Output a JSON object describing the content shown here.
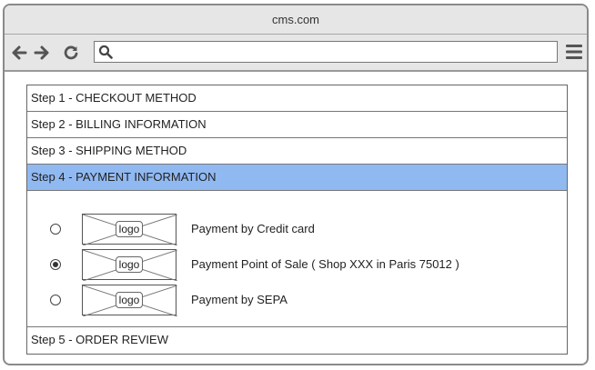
{
  "browser": {
    "title": "cms.com",
    "url": ""
  },
  "steps": {
    "s1": "Step 1 - CHECKOUT METHOD",
    "s2": "Step 2 - BILLING INFORMATION",
    "s3": "Step 3 - SHIPPING METHOD",
    "s4": "Step 4 - PAYMENT INFORMATION",
    "s5": "Step 5 - ORDER REVIEW"
  },
  "payment": {
    "options": [
      {
        "logo": "logo",
        "label": "Payment by Credit card",
        "selected": false
      },
      {
        "logo": "logo",
        "label": "Payment Point of Sale ( Shop XXX in Paris 75012 )",
        "selected": true
      },
      {
        "logo": "logo",
        "label": "Payment by SEPA",
        "selected": false
      }
    ]
  },
  "colors": {
    "active_step": "#90b9f2",
    "chrome": "#e6e6e6"
  },
  "icons": {
    "back": "arrow-left-icon",
    "forward": "arrow-right-icon",
    "reload": "reload-icon",
    "search": "search-icon",
    "menu": "hamburger-menu-icon"
  }
}
